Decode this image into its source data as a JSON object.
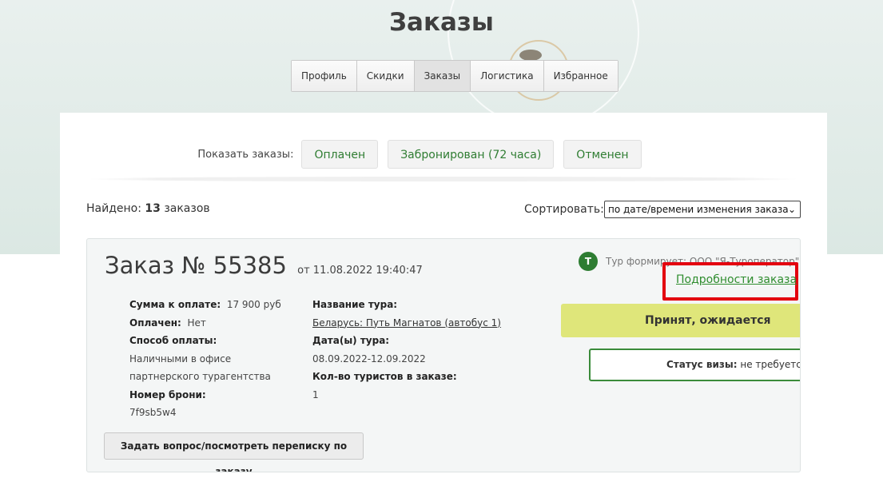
{
  "page": {
    "title": "Заказы"
  },
  "tabs": [
    {
      "label": "Профиль"
    },
    {
      "label": "Скидки"
    },
    {
      "label": "Заказы",
      "active": true
    },
    {
      "label": "Логистика"
    },
    {
      "label": "Избранное"
    }
  ],
  "filters": {
    "label": "Показать заказы:",
    "buttons": [
      "Оплачен",
      "Забронирован (72 часа)",
      "Отменен"
    ]
  },
  "results": {
    "found_label": "Найдено:",
    "found_count": "13",
    "found_suffix": "заказов",
    "sort_label": "Сортировать:",
    "sort_value": "по дате/времени изменения заказа"
  },
  "order": {
    "title": "Заказ № 55385",
    "date": "от 11.08.2022 19:40:47",
    "sum_label": "Сумма к оплате:",
    "sum_value": "17 900 руб",
    "paid_label": "Оплачен:",
    "paid_value": "Нет",
    "payment_label": "Способ оплаты:",
    "payment_value_line1": "Наличными в офисе",
    "payment_value_line2": "партнерского турагентства",
    "booking_label": "Номер брони:",
    "booking_value": "7f9sb5w4",
    "tour_name_label": "Название тура:",
    "tour_name_value": "Беларусь: Путь Магнатов (автобус 1)",
    "tour_dates_label": "Дата(ы) тура:",
    "tour_dates_value": "08.09.2022-12.09.2022",
    "tourists_label": "Кол-во туристов в заказе:",
    "tourists_value": "1",
    "operator_badge": "T",
    "operator_text": "Тур формирует: ООО \"Я-Туроператор\"",
    "details_link": "Подробности заказа",
    "status": "Принят, ожидается оплата",
    "visa_label": "Статус визы:",
    "visa_value": "не требуется",
    "ask_button": "Задать вопрос/посмотреть переписку по заказу"
  },
  "colors": {
    "accent_green": "#2f7d32",
    "status_bg": "#dfe67a",
    "highlight_red": "#e3000f"
  }
}
